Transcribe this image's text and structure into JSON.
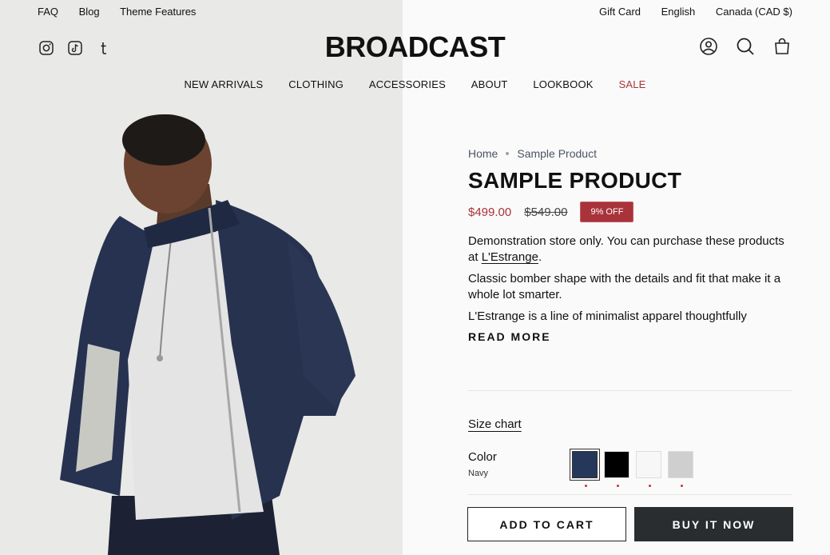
{
  "utility": {
    "left": [
      "FAQ",
      "Blog",
      "Theme Features"
    ],
    "right": [
      "Gift Card",
      "English",
      "Canada (CAD $)"
    ]
  },
  "header": {
    "logo": "BROADCAST",
    "social_icons": [
      "instagram-icon",
      "tiktok-icon",
      "tumblr-icon"
    ],
    "action_icons": [
      "account-icon",
      "search-icon",
      "cart-icon"
    ]
  },
  "nav": {
    "items": [
      "NEW ARRIVALS",
      "CLOTHING",
      "ACCESSORIES",
      "ABOUT",
      "LOOKBOOK",
      "SALE"
    ]
  },
  "product": {
    "breadcrumb": [
      "Home",
      "Sample Product"
    ],
    "title": "SAMPLE PRODUCT",
    "price": "$499.00",
    "compare_price": "$549.00",
    "discount_badge": "9% OFF",
    "description": {
      "p1_before": "Demonstration store only. You can purchase these products at ",
      "p1_link": "L'Estrange",
      "p1_after": ".",
      "p2": "Classic bomber shape with the details and fit that make it a whole lot smarter.",
      "p3": "L'Estrange is a line of minimalist apparel thoughtfully"
    },
    "read_more": "READ MORE",
    "size_chart": "Size chart",
    "color_label": "Color",
    "color_value": "Navy",
    "swatches": [
      {
        "name": "Navy",
        "color": "#25375a",
        "selected": true
      },
      {
        "name": "Black",
        "color": "#000000",
        "selected": false
      },
      {
        "name": "White",
        "color": "#f7f7f7",
        "selected": false
      },
      {
        "name": "Grey",
        "color": "#cfcfcf",
        "selected": false
      }
    ],
    "add_to_cart": "ADD TO CART",
    "buy_now": "BUY IT NOW"
  },
  "colors": {
    "accent_sale": "#a8333a",
    "button_dark": "#2a2d30"
  }
}
